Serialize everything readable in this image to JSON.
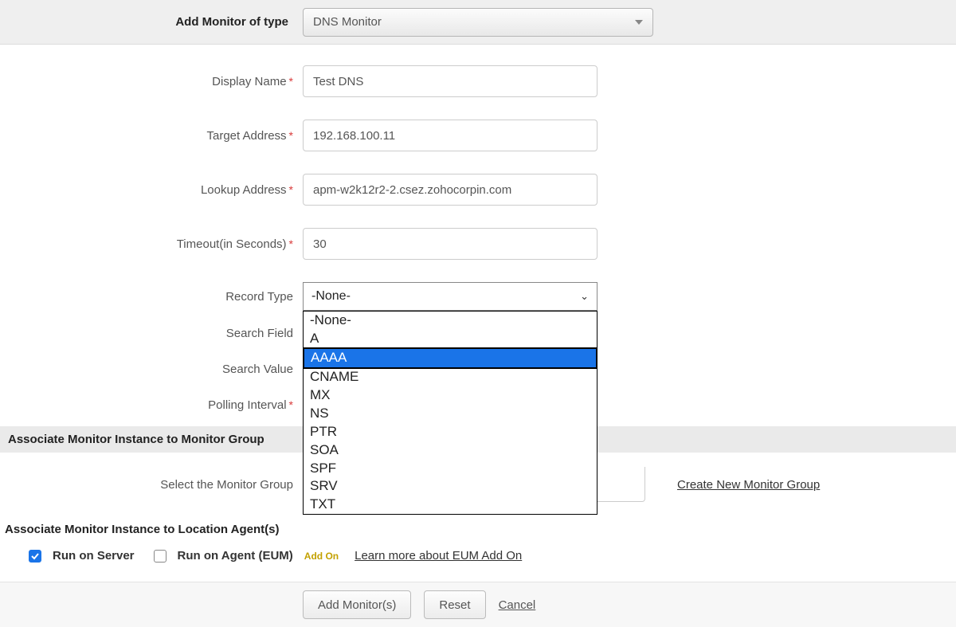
{
  "header": {
    "label": "Add Monitor of type",
    "selected": "DNS Monitor"
  },
  "fields": {
    "display_name": {
      "label": "Display Name",
      "value": "Test DNS"
    },
    "target_address": {
      "label": "Target Address",
      "value": "192.168.100.11"
    },
    "lookup_address": {
      "label": "Lookup Address",
      "value": "apm-w2k12r2-2.csez.zohocorpin.com"
    },
    "timeout": {
      "label": "Timeout(in Seconds)",
      "value": "30"
    },
    "record_type": {
      "label": "Record Type",
      "selected": "-None-",
      "options": [
        "-None-",
        "A",
        "AAAA",
        "CNAME",
        "MX",
        "NS",
        "PTR",
        "SOA",
        "SPF",
        "SRV",
        "TXT"
      ],
      "highlighted": "AAAA"
    },
    "search_field": {
      "label": "Search Field"
    },
    "search_value": {
      "label": "Search Value"
    },
    "polling_interval": {
      "label": "Polling Interval"
    }
  },
  "sections": {
    "monitor_group": {
      "heading": "Associate Monitor Instance to Monitor Group(s)",
      "heading_visible": "Associate Monitor Instance to Monitor Group",
      "select_label": "Select the Monitor Group",
      "create_link": "Create New Monitor Group"
    },
    "location_agent": {
      "heading": "Associate Monitor Instance to Location Agent(s)",
      "run_server": "Run on Server",
      "run_agent": "Run on Agent  (EUM)",
      "addon": "Add On",
      "learn": "Learn more about EUM Add On"
    }
  },
  "buttons": {
    "add": "Add Monitor(s)",
    "reset": "Reset",
    "cancel": "Cancel"
  }
}
